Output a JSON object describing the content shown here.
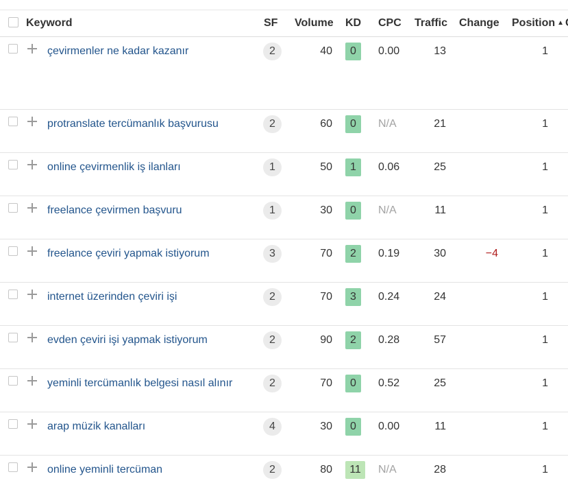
{
  "header": {
    "keyword": "Keyword",
    "sf": "SF",
    "volume": "Volume",
    "kd": "KD",
    "cpc": "CPC",
    "traffic": "Traffic",
    "change": "Change",
    "position": "Position",
    "sort_icon": "▲",
    "extra": "C"
  },
  "rows": [
    {
      "keyword": "çevirmenler ne kadar kazanır",
      "sf": "2",
      "volume": "40",
      "kd": "0",
      "cpc": "0.00",
      "traffic": "13",
      "change": "",
      "position": "1"
    },
    {
      "keyword": "protranslate tercümanlık başvurusu",
      "sf": "2",
      "volume": "60",
      "kd": "0",
      "cpc": "N/A",
      "traffic": "21",
      "change": "",
      "position": "1"
    },
    {
      "keyword": "online çevirmenlik iş ilanları",
      "sf": "1",
      "volume": "50",
      "kd": "1",
      "cpc": "0.06",
      "traffic": "25",
      "change": "",
      "position": "1"
    },
    {
      "keyword": "freelance çevirmen başvuru",
      "sf": "1",
      "volume": "30",
      "kd": "0",
      "cpc": "N/A",
      "traffic": "11",
      "change": "",
      "position": "1"
    },
    {
      "keyword": "freelance çeviri yapmak istiyorum",
      "sf": "3",
      "volume": "70",
      "kd": "2",
      "cpc": "0.19",
      "traffic": "30",
      "change": "−4",
      "position": "1"
    },
    {
      "keyword": "internet üzerinden çeviri işi",
      "sf": "2",
      "volume": "70",
      "kd": "3",
      "cpc": "0.24",
      "traffic": "24",
      "change": "",
      "position": "1"
    },
    {
      "keyword": "evden çeviri işi yapmak istiyorum",
      "sf": "2",
      "volume": "90",
      "kd": "2",
      "cpc": "0.28",
      "traffic": "57",
      "change": "",
      "position": "1"
    },
    {
      "keyword": "yeminli tercümanlık belgesi nasıl alınır",
      "sf": "2",
      "volume": "70",
      "kd": "0",
      "cpc": "0.52",
      "traffic": "25",
      "change": "",
      "position": "1"
    },
    {
      "keyword": "arap müzik kanalları",
      "sf": "4",
      "volume": "30",
      "kd": "0",
      "cpc": "0.00",
      "traffic": "11",
      "change": "",
      "position": "1"
    },
    {
      "keyword": "online yeminli tercüman",
      "sf": "2",
      "volume": "80",
      "kd": "11",
      "cpc": "N/A",
      "traffic": "28",
      "change": "",
      "position": "1"
    }
  ],
  "colors": {
    "keyword_link": "#23558c",
    "kd_badge": "#8fd3a9",
    "kd_badge_light": "#bde5b6",
    "sf_badge": "#ebebeb",
    "change_negative": "#b01e1e",
    "na_text": "#a3a3a3"
  }
}
